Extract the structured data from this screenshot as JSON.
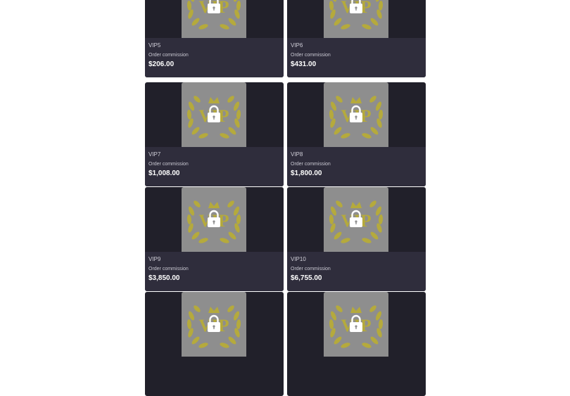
{
  "vip_cards": [
    {
      "level": "VIP5",
      "commission_label": "Order commission",
      "amount": "$206.00"
    },
    {
      "level": "VIP6",
      "commission_label": "Order commission",
      "amount": "$431.00"
    },
    {
      "level": "VIP7",
      "commission_label": "Order commission",
      "amount": "$1,008.00"
    },
    {
      "level": "VIP8",
      "commission_label": "Order commission",
      "amount": "$1,800.00"
    },
    {
      "level": "VIP9",
      "commission_label": "Order commission",
      "amount": "$3,850.00"
    },
    {
      "level": "VIP10",
      "commission_label": "Order commission",
      "amount": "$6,755.00"
    },
    {
      "level": "",
      "commission_label": "",
      "amount": ""
    },
    {
      "level": "",
      "commission_label": "",
      "amount": ""
    }
  ],
  "badge": {
    "text": "VIP",
    "icon": "lock-icon",
    "wreath": "laurel-wreath"
  },
  "colors": {
    "gold": "#b5aa3c",
    "thumb_bg": "#8e8e8e",
    "card_bg": "#21202a",
    "info_bg": "#2f2d3c"
  }
}
